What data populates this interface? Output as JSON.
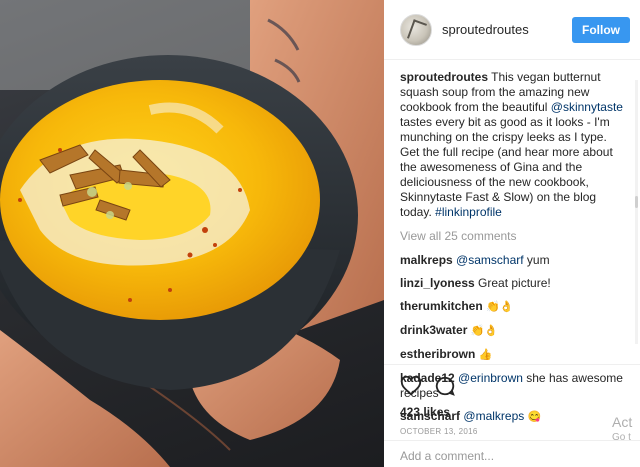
{
  "post": {
    "username": "sproutedroutes",
    "follow_label": "Follow",
    "caption": {
      "username": "sproutedroutes",
      "text_1": " This vegan butternut squash soup from the amazing new cookbook from the beautiful ",
      "mention": "@skinnytaste",
      "text_2": " tastes every bit as good as it looks - I'm munching on the crispy leeks as I type. Get the full recipe (and hear more about the awesomeness of Gina and the deliciousness of the new cookbook, Skinnytaste Fast & Slow) on the blog today. ",
      "hashtag": "#linkinprofile"
    },
    "view_all": "View all 25 comments",
    "comments": [
      {
        "user": "malkreps",
        "mention": "@samscharf",
        "text": " yum",
        "emoji": ""
      },
      {
        "user": "linzi_lyoness",
        "mention": "",
        "text": " Great picture!",
        "emoji": ""
      },
      {
        "user": "therumkitchen",
        "mention": "",
        "text": " ",
        "emoji": "👏👌"
      },
      {
        "user": "drink3water",
        "mention": "",
        "text": " ",
        "emoji": "👏👌"
      },
      {
        "user": "estheribrown",
        "mention": "",
        "text": " ",
        "emoji": "👍"
      },
      {
        "user": "kadade12",
        "mention": "@erinbrown",
        "text": " she has awesome recipes",
        "emoji": ""
      },
      {
        "user": "samscharf",
        "mention": "@malkreps",
        "text": " ",
        "emoji": "😋"
      }
    ],
    "likes": "423 likes",
    "date": "OCTOBER 13, 2016",
    "add_comment_placeholder": "Add a comment...",
    "icons": {
      "like": "heart-icon",
      "comment": "comment-bubble-icon"
    },
    "colors": {
      "follow": "#3897f0",
      "link": "#003569",
      "muted": "#999999"
    }
  },
  "watermark": {
    "line1": "Act",
    "line2": "Go t"
  }
}
